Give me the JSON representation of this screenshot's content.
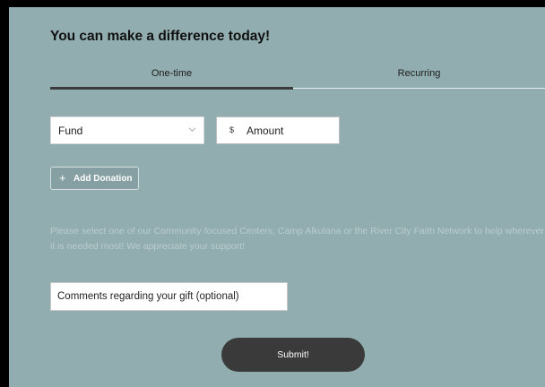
{
  "form": {
    "heading": "You can make a difference today!",
    "tabs": [
      {
        "label": "One-time",
        "active": true
      },
      {
        "label": "Recurring",
        "active": false
      }
    ],
    "fund_select": {
      "value": "Fund",
      "icon": "chevron-down-icon"
    },
    "amount_field": {
      "currency": "$",
      "placeholder": "Amount"
    },
    "add_donation_button": {
      "icon": "plus-icon",
      "label": "Add Donation"
    },
    "note": "Please select one of our Community focused Centers, Camp Alkulana or the River City Faith Network to help wherever it is needed most! We appreciate your support!",
    "comments_field": {
      "placeholder": "Comments regarding your gift  (optional)"
    },
    "submit_button": {
      "label": "Submit!"
    }
  },
  "colors": {
    "panel_background": "#92adaf",
    "frame": "#000000",
    "button_dark": "#3a3a3a",
    "note_text": "#b9cccd"
  }
}
